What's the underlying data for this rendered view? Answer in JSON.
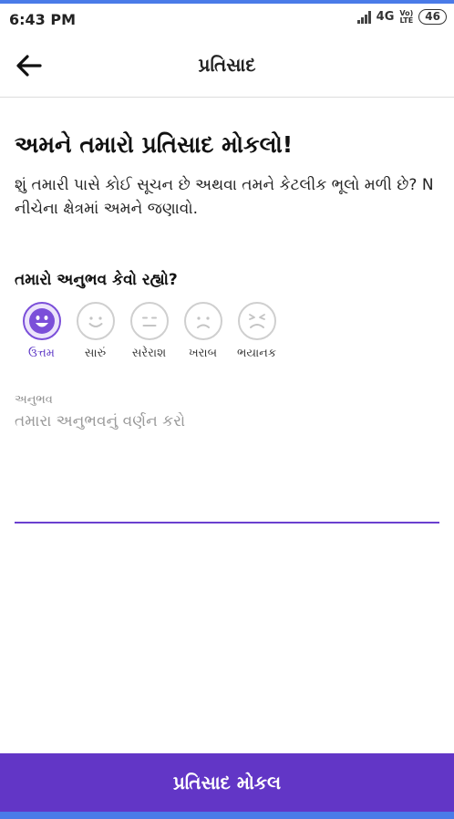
{
  "status_bar": {
    "time": "6:43 PM",
    "network": "4G",
    "volte": [
      "Vo)",
      "LTE"
    ],
    "battery": "46"
  },
  "app_bar": {
    "title": "પ્રતિસાદ",
    "back_icon": "arrow-left-icon"
  },
  "content": {
    "heading": "અમને તમારો પ્રતિસાદ મોકલો!",
    "description": "શું તમારી પાસે કોઈ સૂચન છે અથવા તમને કેટલીક ભૂલો મળી છે? N નીચેના ક્ષેત્રમાં અમને જણાવો.",
    "rating_label": "તમારો અનુભવ કેવો રહ્યો?",
    "ratings": [
      {
        "label": "ઉત્તમ",
        "icon": "very-happy-face-icon",
        "selected": true
      },
      {
        "label": "સારું",
        "icon": "happy-face-icon",
        "selected": false
      },
      {
        "label": "સરેરાશ",
        "icon": "neutral-face-icon",
        "selected": false
      },
      {
        "label": "ખરાબ",
        "icon": "sad-face-icon",
        "selected": false
      },
      {
        "label": "ભયાનક",
        "icon": "angry-face-icon",
        "selected": false
      }
    ],
    "experience_field": {
      "label": "અનુભવ",
      "placeholder": "તમારા અનુભવનું વર્ણન કરો",
      "value": ""
    }
  },
  "submit_button": {
    "label": "પ્રતિસાદ મોકલ"
  },
  "colors": {
    "accent": "#6236c6",
    "selected_face": "#7b4fd9",
    "face_outline": "#cfcfcf",
    "system_stripe": "#4a7be8"
  }
}
